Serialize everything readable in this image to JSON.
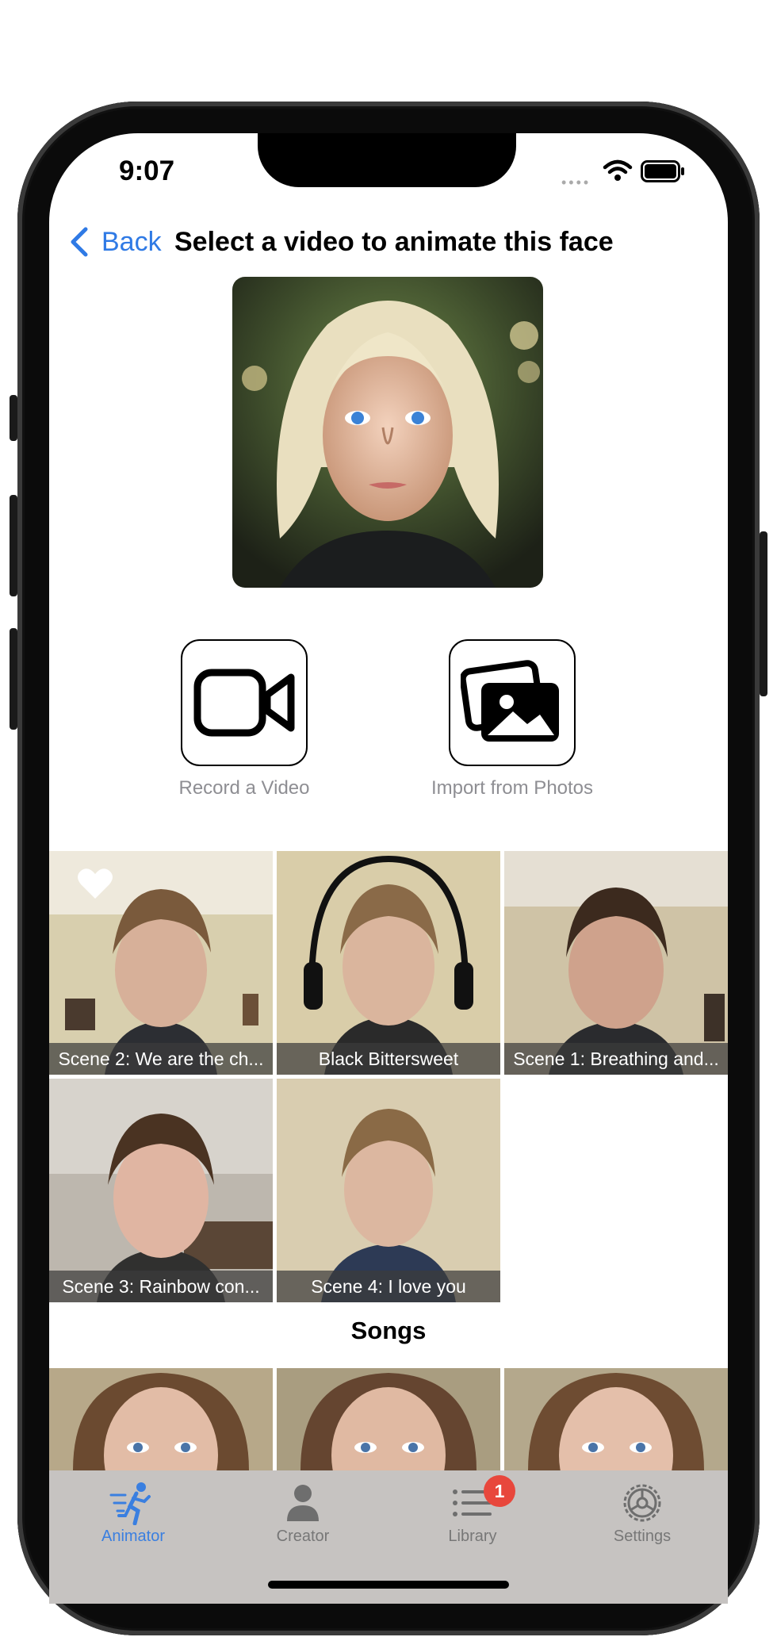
{
  "status_bar": {
    "time": "9:07"
  },
  "nav": {
    "back_label": "Back",
    "title": "Select a video to animate this face"
  },
  "actions": {
    "record_label": "Record a Video",
    "import_label": "Import from Photos"
  },
  "videos": [
    {
      "caption": "Scene 2: We are the ch...",
      "favorite": true
    },
    {
      "caption": "Black Bittersweet",
      "favorite": false
    },
    {
      "caption": "Scene 1: Breathing and...",
      "favorite": false
    },
    {
      "caption": "Scene 3: Rainbow con...",
      "favorite": false
    },
    {
      "caption": "Scene 4: I love you",
      "favorite": false
    }
  ],
  "songs_section": {
    "title": "Songs"
  },
  "tab_bar": {
    "items": [
      {
        "label": "Animator",
        "icon": "runner-icon",
        "active": true
      },
      {
        "label": "Creator",
        "icon": "person-icon",
        "active": false
      },
      {
        "label": "Library",
        "icon": "list-icon",
        "active": false,
        "badge": "1"
      },
      {
        "label": "Settings",
        "icon": "gear-icon",
        "active": false
      }
    ]
  },
  "colors": {
    "accent": "#2f7ae5",
    "badge": "#e8473c",
    "tab_bar_bg": "#c6c3c1"
  }
}
